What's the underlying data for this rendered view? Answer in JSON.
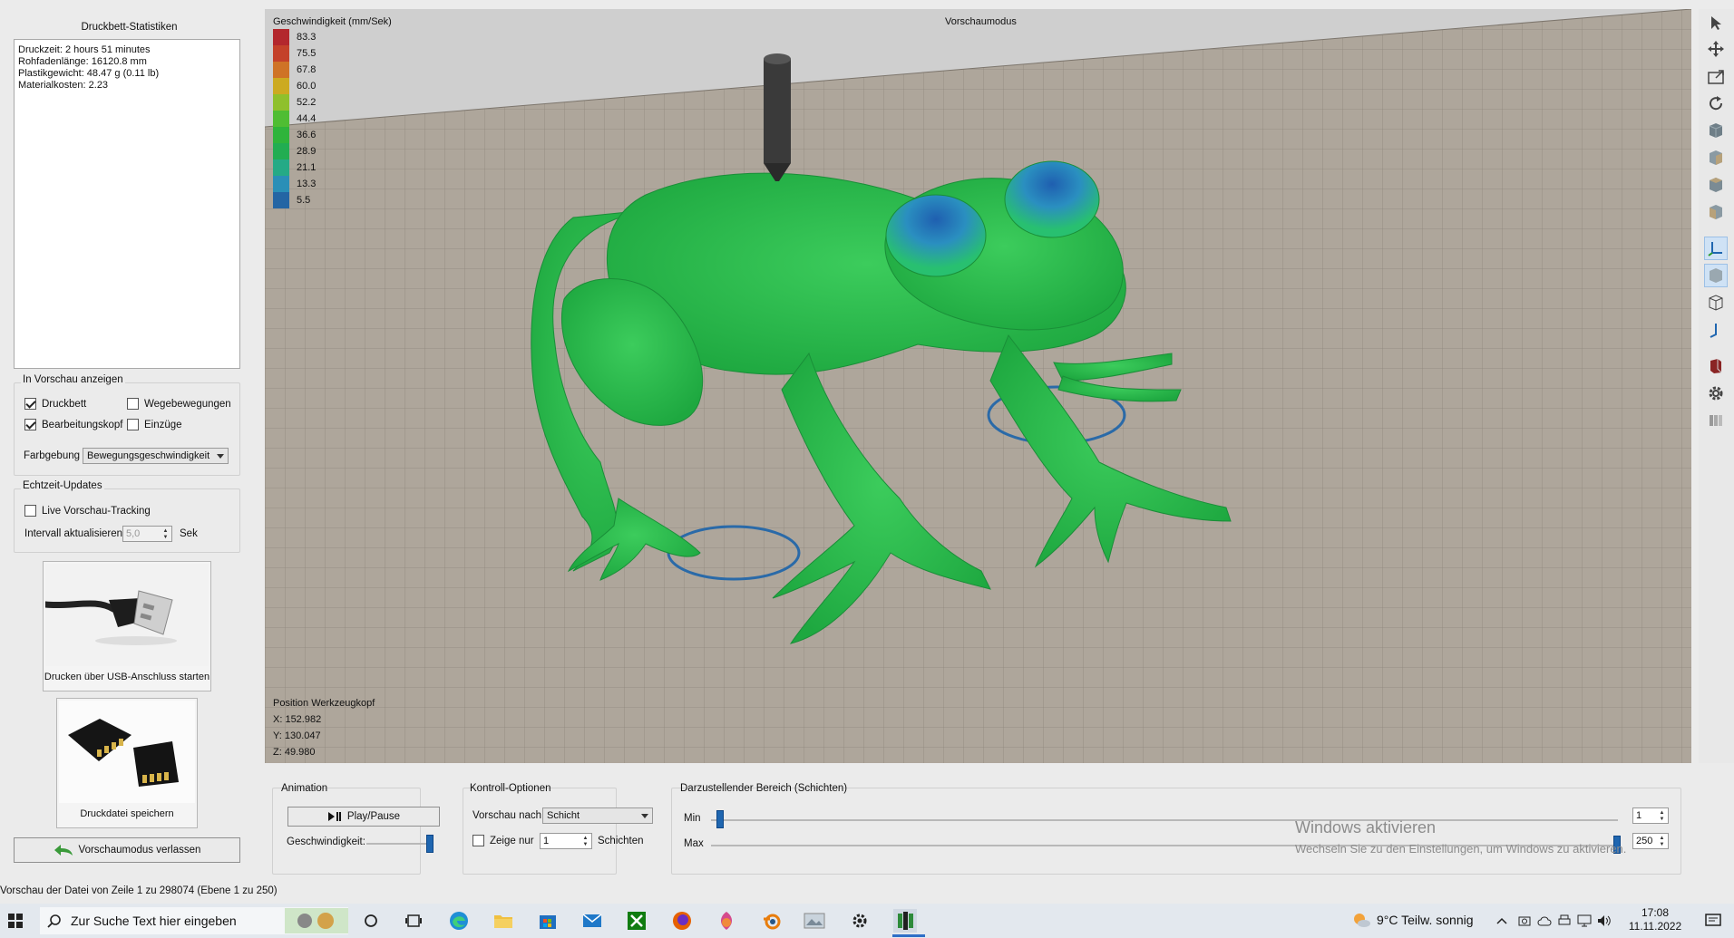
{
  "stats": {
    "title": "Druckbett-Statistiken",
    "lines": [
      "Druckzeit: 2 hours 51 minutes",
      "Rohfadenlänge: 16120.8 mm",
      "Plastikgewicht: 48.47 g (0.11 lb)",
      "Materialkosten: 2.23"
    ]
  },
  "show_in_preview": {
    "title": "In Vorschau anzeigen",
    "druckbett": "Druckbett",
    "wegebewegungen": "Wegebewegungen",
    "bearbeitungskopf": "Bearbeitungskopf",
    "einzuege": "Einzüge",
    "farbgebung_label": "Farbgebung",
    "farbgebung_value": "Bewegungsgeschwindigkeit"
  },
  "realtime": {
    "title": "Echtzeit-Updates",
    "live_tracking": "Live Vorschau-Tracking",
    "interval_label": "Intervall aktualisieren",
    "interval_value": "5,0",
    "interval_unit": "Sek"
  },
  "usb_button": "Drucken über USB-Anschluss starten",
  "save_button": "Druckdatei speichern",
  "exit_button": "Vorschaumodus verlassen",
  "viewport": {
    "mode": "Vorschaumodus",
    "legend_title": "Geschwindigkeit (mm/Sek)",
    "legend": [
      {
        "value": "83.3",
        "color": "#b3272d"
      },
      {
        "value": "75.5",
        "color": "#c4412a"
      },
      {
        "value": "67.8",
        "color": "#cf7326"
      },
      {
        "value": "60.0",
        "color": "#ccaa21"
      },
      {
        "value": "52.2",
        "color": "#8fc02c"
      },
      {
        "value": "44.4",
        "color": "#4fbd33"
      },
      {
        "value": "36.6",
        "color": "#2fb43b"
      },
      {
        "value": "28.9",
        "color": "#22ad52"
      },
      {
        "value": "21.1",
        "color": "#25aa86"
      },
      {
        "value": "13.3",
        "color": "#2a8fb7"
      },
      {
        "value": "5.5",
        "color": "#2465a4"
      }
    ],
    "toolhead_title": "Position Werkzeugkopf",
    "x": "X: 152.982",
    "y": "Y: 130.047",
    "z": "Z: 49.980"
  },
  "animation": {
    "title": "Animation",
    "play_pause": "Play/Pause",
    "speed_label": "Geschwindigkeit:"
  },
  "control": {
    "title": "Kontroll-Optionen",
    "preview_by_label": "Vorschau nach",
    "preview_by_value": "Schicht",
    "show_only_label": "Zeige nur",
    "show_only_value": "1",
    "layers_label": "Schichten"
  },
  "range": {
    "title": "Darzustellender Bereich (Schichten)",
    "min_label": "Min",
    "max_label": "Max",
    "min_value": "1",
    "max_value": "250"
  },
  "watermark": {
    "title": "Windows aktivieren",
    "subtitle": "Wechseln Sie zu den Einstellungen, um Windows zu aktivieren."
  },
  "status_text": "Vorschau der Datei von Zeile 1 zu 298074 (Ebene 1 zu 250)",
  "taskbar": {
    "search_placeholder": "Zur Suche Text hier eingeben",
    "weather": "9°C  Teilw. sonnig",
    "time": "17:08",
    "date": "11.11.2022"
  }
}
